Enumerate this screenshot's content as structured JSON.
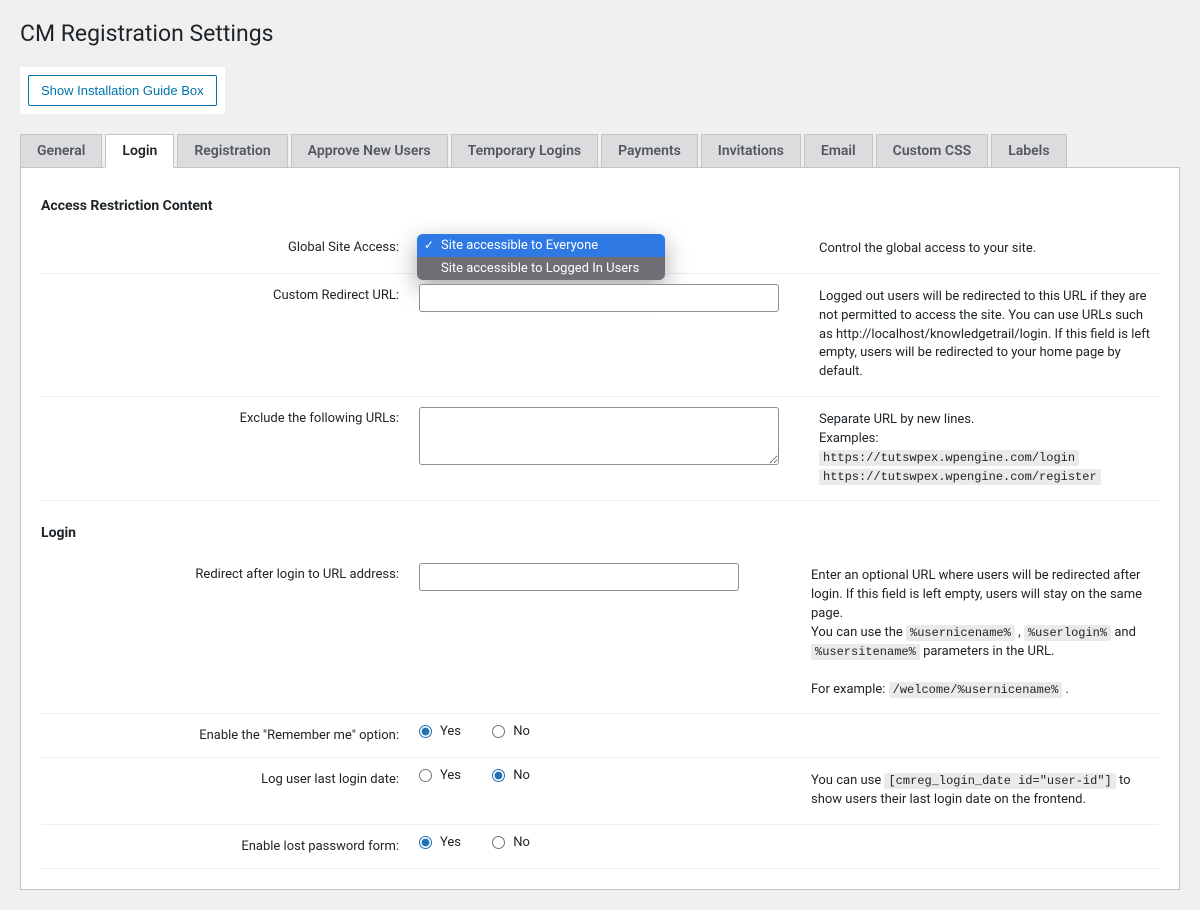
{
  "page_title": "CM Registration Settings",
  "install_button": "Show Installation Guide Box",
  "tabs": [
    "General",
    "Login",
    "Registration",
    "Approve New Users",
    "Temporary Logins",
    "Payments",
    "Invitations",
    "Email",
    "Custom CSS",
    "Labels"
  ],
  "active_tab": "Login",
  "sections": {
    "access": {
      "heading": "Access Restriction Content",
      "global_label": "Global Site Access:",
      "global_desc": "Control the global access to your site.",
      "dropdown": {
        "selected": "Site accessible to Everyone",
        "other": "Site accessible to Logged In Users"
      },
      "redirect_label": "Custom Redirect URL:",
      "redirect_value": "",
      "redirect_desc": "Logged out users will be redirected to this URL if they are not permitted to access the site. You can use URLs such as http://localhost/knowledgetrail/login. If this field is left empty, users will be redirected to your home page by default.",
      "exclude_label": "Exclude the following URLs:",
      "exclude_value": "",
      "exclude_desc_1": "Separate URL by new lines.",
      "exclude_desc_2": "Examples:",
      "exclude_ex_1": "https://tutswpex.wpengine.com/login",
      "exclude_ex_2": "https://tutswpex.wpengine.com/register"
    },
    "login": {
      "heading": "Login",
      "redirect_label": "Redirect after login to URL address:",
      "redirect_value": "",
      "redirect_desc_1": "Enter an optional URL where users will be redirected after login. If this field is left empty, users will stay on the same page.",
      "redirect_desc_2a": "You can use the ",
      "redirect_desc_2b": " , ",
      "redirect_desc_2c": " and ",
      "redirect_desc_2d": " parameters in the URL.",
      "code1": "%usernicename%",
      "code2": "%userlogin%",
      "code3": "%usersitename%",
      "redirect_desc_3a": "For example: ",
      "code4": "/welcome/%usernicename%",
      "redirect_desc_3b": " .",
      "remember_label": "Enable the \"Remember me\" option:",
      "yes": "Yes",
      "no": "No",
      "loglast_label": "Log user last login date:",
      "loglast_desc_a": "You can use ",
      "loglast_code": "[cmreg_login_date id=\"user-id\"]",
      "loglast_desc_b": " to show users their last login date on the frontend.",
      "lostpw_label": "Enable lost password form:"
    }
  }
}
